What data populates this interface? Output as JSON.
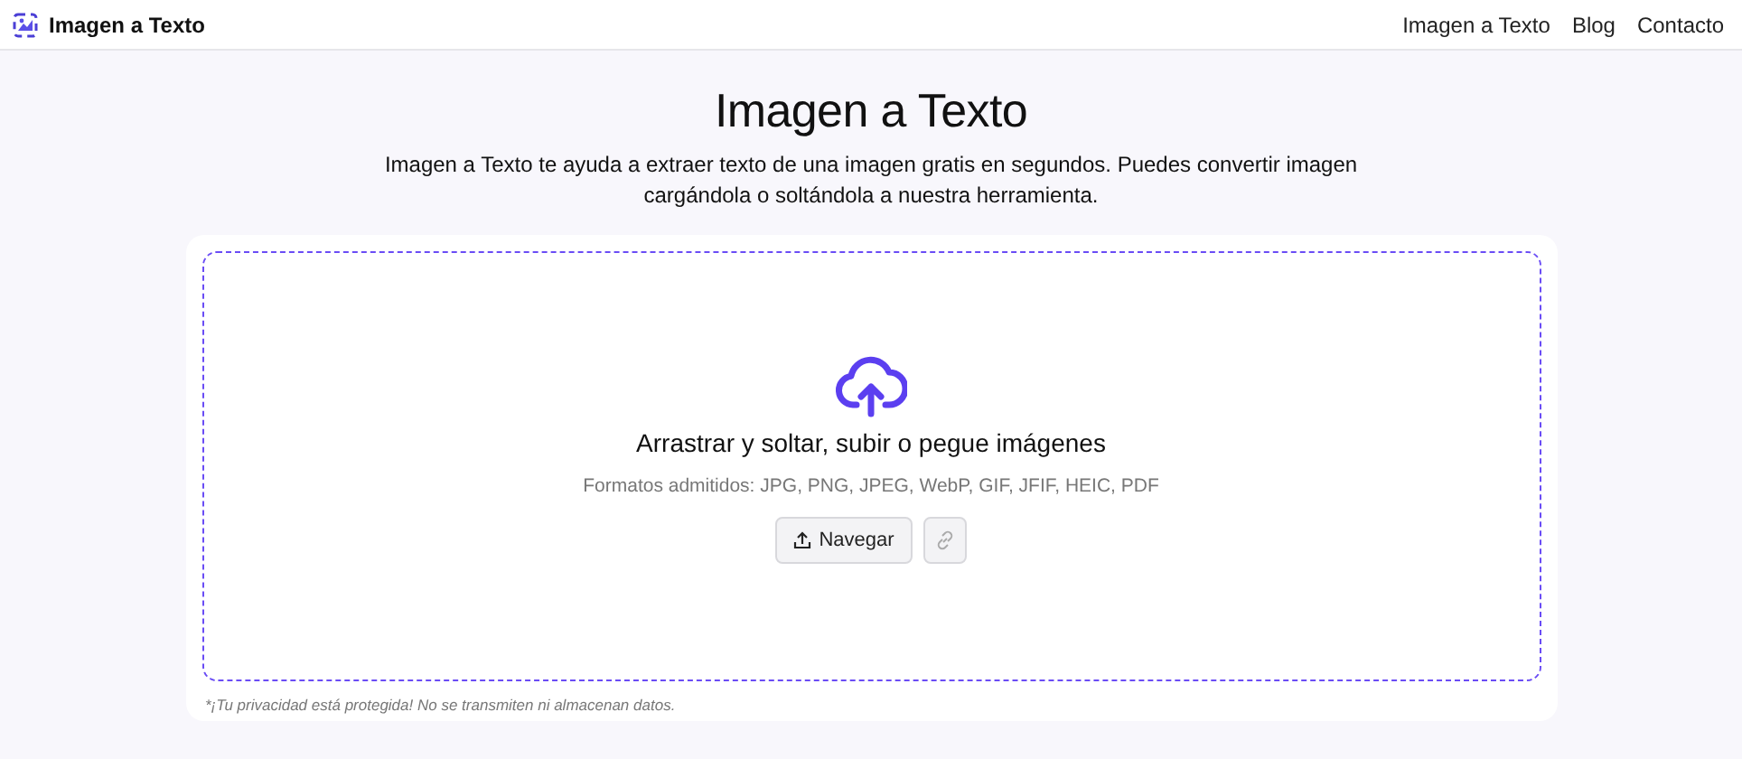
{
  "header": {
    "brand": "Imagen a Texto",
    "nav": [
      {
        "label": "Imagen a Texto"
      },
      {
        "label": "Blog"
      },
      {
        "label": "Contacto"
      }
    ]
  },
  "hero": {
    "title": "Imagen a Texto",
    "description": "Imagen a Texto te ayuda a extraer texto de una imagen gratis en segundos. Puedes convertir imagen cargándola o soltándola a nuestra herramienta."
  },
  "upload": {
    "prompt": "Arrastrar y soltar, subir o pegue imágenes",
    "formats": "Formatos admitidos: JPG, PNG, JPEG, WebP, GIF, JFIF, HEIC, PDF",
    "browse_button": "Navegar",
    "privacy_note": "*¡Tu privacidad está protegida! No se transmiten ni almacenan datos."
  }
}
